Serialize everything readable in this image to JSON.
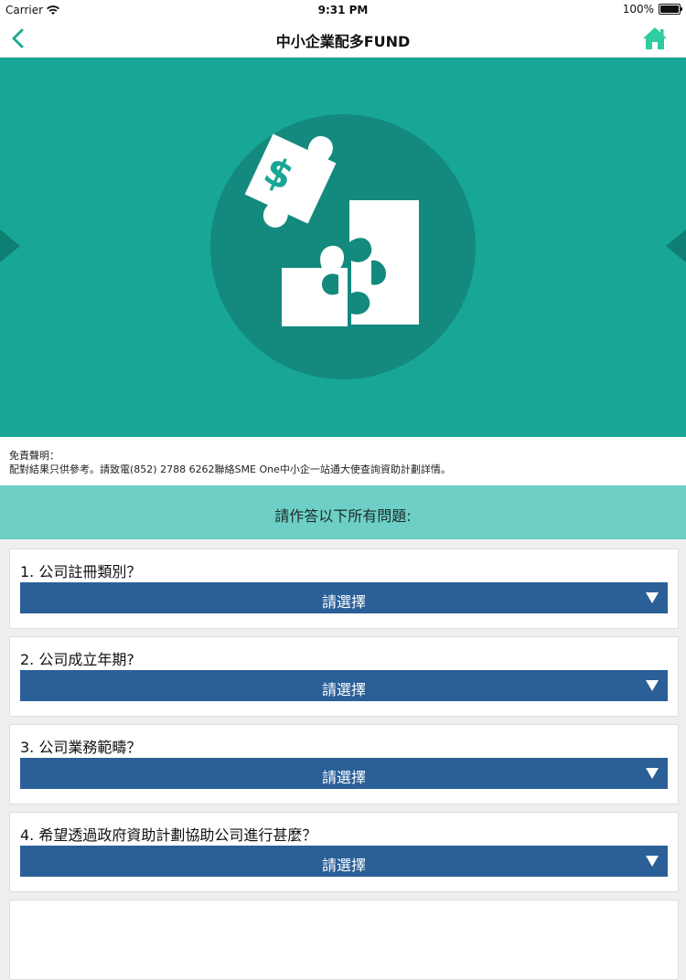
{
  "status_bar": {
    "carrier": "Carrier",
    "time": "9:31 PM",
    "battery": "100%"
  },
  "nav": {
    "title": "中小企業配多FUND",
    "back_icon": "chevron-left-icon",
    "home_icon": "home-icon"
  },
  "hero": {
    "icon": "puzzle-dollar-icon"
  },
  "disclaimer": {
    "heading": "免責聲明：",
    "text": "配對結果只供參考。請致電(852) 2788 6262聯絡SME One中小企一站通大使查詢資助計劃詳情。"
  },
  "banner": {
    "text": "請作答以下所有問題:"
  },
  "questions": [
    {
      "label": "1. 公司註冊類別？",
      "value": "請選擇"
    },
    {
      "label": "2. 公司成立年期?",
      "value": "請選擇"
    },
    {
      "label": "3. 公司業務範疇？",
      "value": "請選擇"
    },
    {
      "label": "4. 希望透過政府資助計劃協助公司進行甚麼？",
      "value": "請選擇"
    }
  ],
  "colors": {
    "accent": "#2ecc9e",
    "hero_bg": "#18a697",
    "hero_circle": "#138a7d",
    "banner_bg": "#6dcfc5",
    "select_bg": "#2a5f97"
  }
}
